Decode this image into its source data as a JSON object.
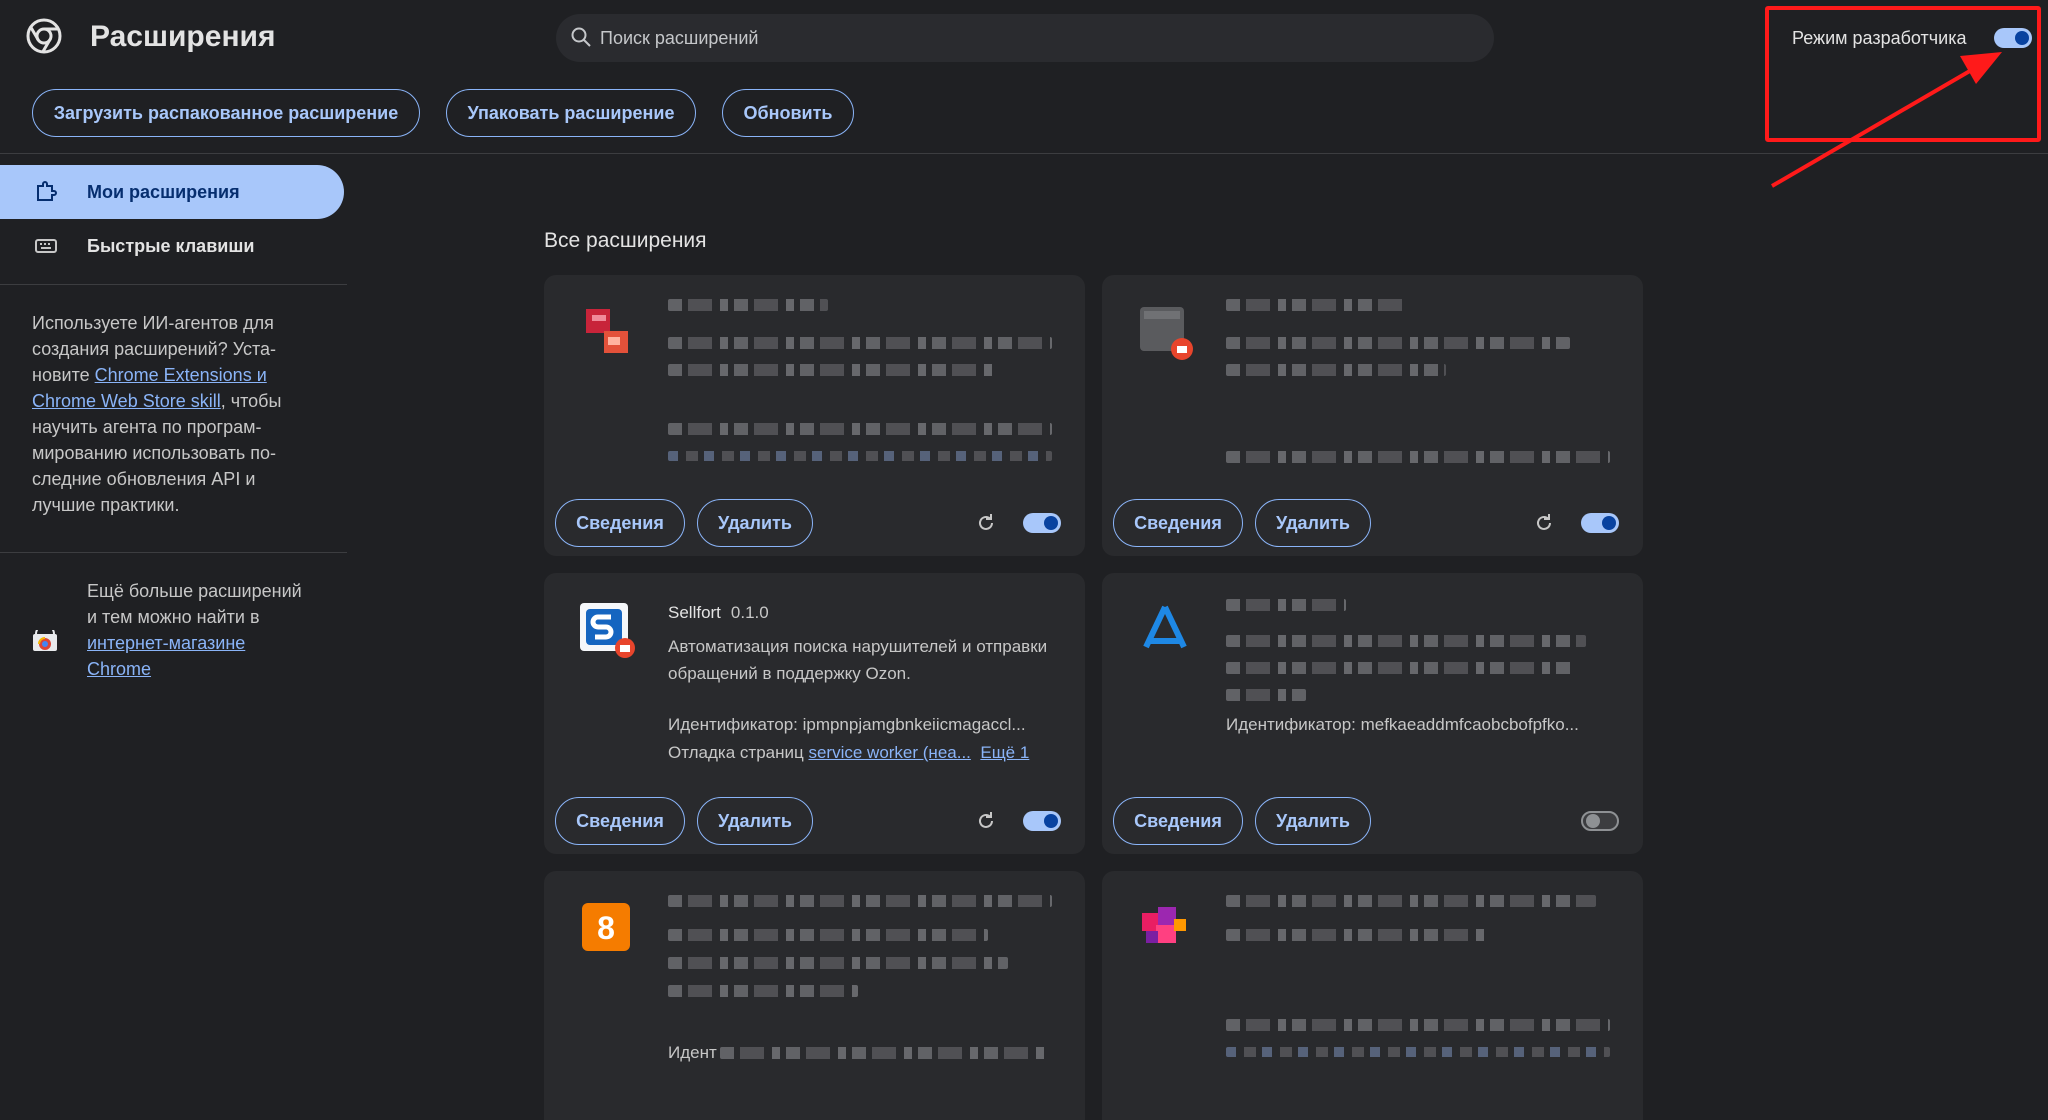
{
  "header": {
    "title": "Расширения",
    "search_placeholder": "Поиск расширений",
    "dev_mode_label": "Режим разработчика",
    "dev_mode_on": true
  },
  "toolbar": {
    "load_unpacked": "Загрузить распакованное расширение",
    "pack": "Упаковать расширение",
    "update": "Обновить"
  },
  "sidebar": {
    "items": [
      {
        "label": "Мои расширения",
        "active": true
      },
      {
        "label": "Быстрые клавиши",
        "active": false
      }
    ],
    "promo_text_1": "Используете ИИ-агентов для создания расширений? Уста­новите ",
    "promo_link": "Chrome Extensions и Chrome Web Store skill",
    "promo_text_2": ", чтобы научить агента по програм­мированию использовать по­следние обновления API и лучшие практики.",
    "store_text": "Ещё больше расширений и тем можно найти в ",
    "store_link": "интернет-магазине Chrome"
  },
  "main": {
    "section_title": "Все расширения",
    "details_label": "Сведения",
    "remove_label": "Удалить",
    "cards": [
      {
        "enabled": true
      },
      {
        "enabled": true
      },
      {
        "name": "Sellfort",
        "version": "0.1.0",
        "description": "Автоматизация поиска нарушителей и отправки обращений в поддержку Ozon.",
        "id_line": "Идентификатор: ipmpnpjamgbnkeiicmagaccl...",
        "debug_prefix": "Отладка страниц ",
        "debug_link": "service worker (неа...",
        "more_link": "Ещё 1",
        "enabled": true
      },
      {
        "id_line": "Идентификатор: mefkaeaddmfcaobcbofpfko...",
        "enabled": false
      },
      {
        "id_prefix": "Идент",
        "enabled": false
      },
      {
        "enabled": true
      }
    ]
  },
  "colors": {
    "background": "#1f2023",
    "card": "#292a2d",
    "accent": "#a8c7fa",
    "annotation_red": "#ff1a1a"
  }
}
